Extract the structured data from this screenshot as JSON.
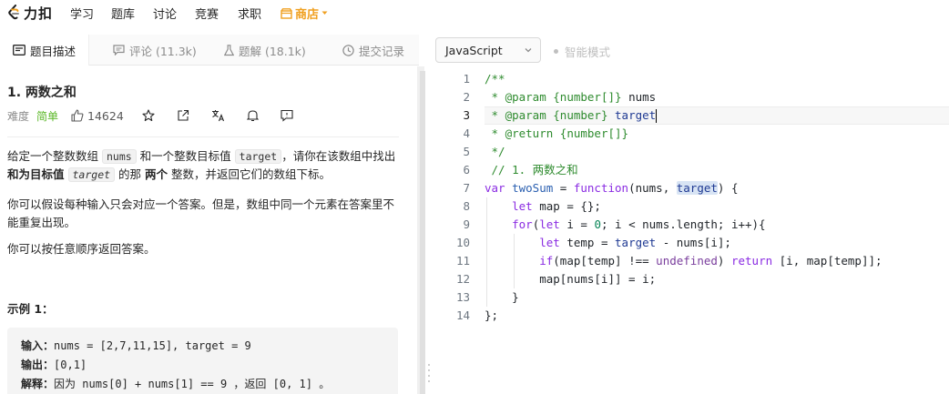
{
  "topnav": {
    "logo_text": "力扣",
    "items": [
      "学习",
      "题库",
      "讨论",
      "竞赛",
      "求职"
    ],
    "shop_label": "商店"
  },
  "left_tabs": {
    "description": "题目描述",
    "comments": "评论 (11.3k)",
    "solutions": "题解 (18.1k)",
    "submissions": "提交记录"
  },
  "problem": {
    "title": "1. 两数之和",
    "difficulty_label": "难度",
    "difficulty": "简单",
    "likes": "14624",
    "p1_a": "给定一个整数数组 ",
    "p1_code1": "nums",
    "p1_b": " 和一个整数目标值 ",
    "p1_code2": "target",
    "p1_c": "，请你在该数组中找出 ",
    "p1_bold1": "和为目标值",
    "p1_code3": "target",
    "p1_d": " 的那 ",
    "p1_bold2": "两个",
    "p1_e": " 整数，并返回它们的数组下标。",
    "p2": "你可以假设每种输入只会对应一个答案。但是，数组中同一个元素在答案里不能重复出现。",
    "p3": "你可以按任意顺序返回答案。",
    "example_title": "示例 1：",
    "example": {
      "input_label": "输入：",
      "input": "nums = [2,7,11,15], target = 9",
      "output_label": "输出：",
      "output": "[0,1]",
      "explain_label": "解释：",
      "explain": "因为 nums[0] + nums[1] == 9 ，返回 [0, 1] 。"
    }
  },
  "editor": {
    "language": "JavaScript",
    "smart_mode": "智能模式",
    "current_line": 3,
    "line_numbers": [
      "1",
      "2",
      "3",
      "4",
      "5",
      "6",
      "7",
      "8",
      "9",
      "10",
      "11",
      "12",
      "13",
      "14"
    ]
  },
  "colors": {
    "accent_green": "#5ab726",
    "shop_orange": "#f0a020",
    "comment_green": "#2e8b2e",
    "keyword_purple": "#8a2be2"
  }
}
